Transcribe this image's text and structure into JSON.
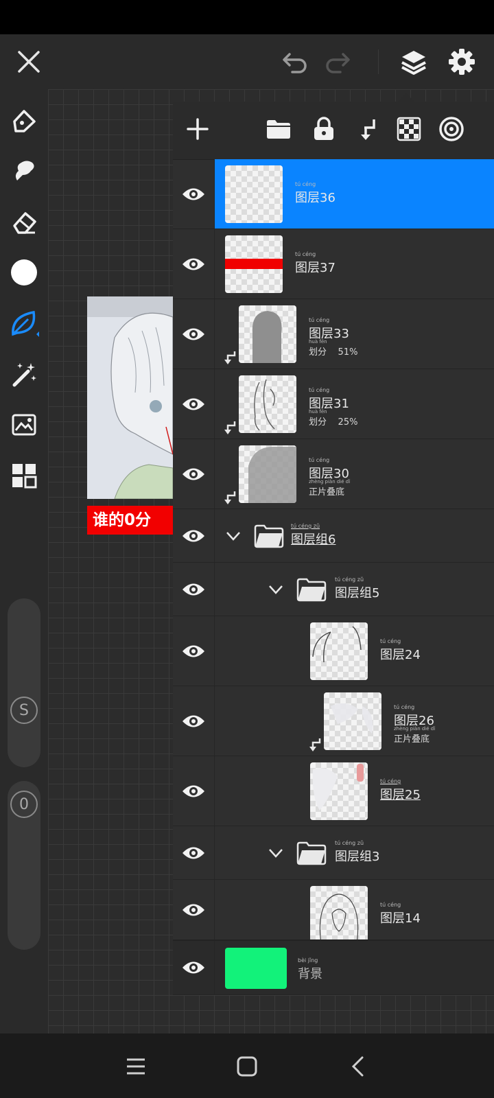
{
  "colors": {
    "accent": "#0a84ff",
    "background_layer": "#12f27a",
    "caption_red": "#f20000",
    "thumb_red_band": "#f00000"
  },
  "artwork": {
    "caption": "谁的0分"
  },
  "layers": [
    {
      "ruby": "tú céng",
      "name": "图层36",
      "blend": "",
      "selected": true
    },
    {
      "ruby": "tú céng",
      "name": "图层37",
      "blend": ""
    },
    {
      "ruby": "tú céng",
      "name": "图层33",
      "blend_ruby": "huà fēn",
      "blend": "划分",
      "opacity": "51%"
    },
    {
      "ruby": "tú céng",
      "name": "图层31",
      "blend_ruby": "huà fēn",
      "blend": "划分",
      "opacity": "25%"
    },
    {
      "ruby": "tú céng",
      "name": "图层30",
      "blend_ruby": "zhèng piàn dié dǐ",
      "blend": "正片叠底"
    },
    {
      "ruby": "tú céng zǔ",
      "name": "图层组6",
      "type": "group"
    },
    {
      "ruby": "tú céng zǔ",
      "name": "图层组5",
      "type": "group"
    },
    {
      "ruby": "tú céng",
      "name": "图层24"
    },
    {
      "ruby": "tú céng",
      "name": "图层26",
      "blend_ruby": "zhèng piàn dié dǐ",
      "blend": "正片叠底"
    },
    {
      "ruby": "tú céng",
      "name": "图层25"
    },
    {
      "ruby": "tú céng zǔ",
      "name": "图层组3",
      "type": "group"
    },
    {
      "ruby": "tú céng",
      "name": "图层14"
    },
    {
      "ruby": "bèi jǐng",
      "name": "背景"
    }
  ],
  "sliders": {
    "size_label": "S",
    "opacity_label": "0"
  }
}
